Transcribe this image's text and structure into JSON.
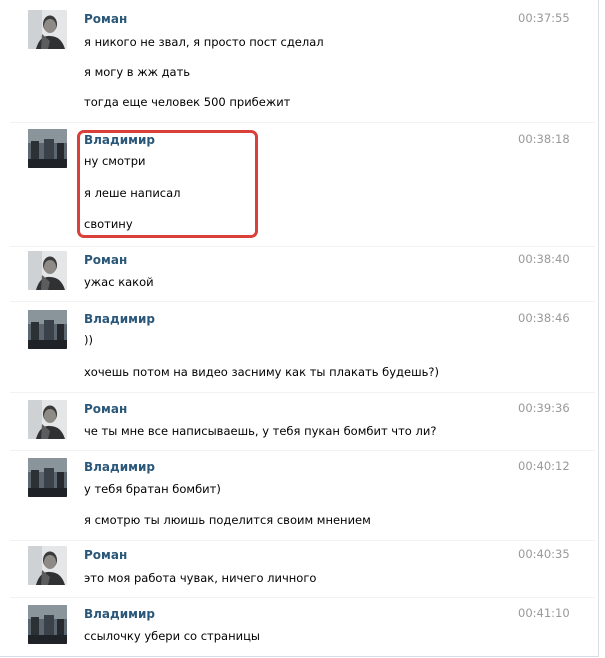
{
  "messages": [
    {
      "author": "Роман",
      "avatar": "roman-avatar-icon",
      "time": "00:37:55",
      "lines": [
        "я никого не звал, я просто пост сделал",
        "я могу в жж дать",
        "тогда еще человек 500 прибежит"
      ]
    },
    {
      "author": "Владимир",
      "avatar": "vladimir-avatar-icon",
      "time": "00:38:18",
      "lines": [
        "ну смотри",
        "я леше написал",
        "свотину"
      ]
    },
    {
      "author": "Роман",
      "avatar": "roman-avatar-icon",
      "time": "00:38:40",
      "lines": [
        "ужас какой"
      ]
    },
    {
      "author": "Владимир",
      "avatar": "vladimir-avatar-icon",
      "time": "00:38:46",
      "lines": [
        "))",
        "хочешь потом на видео засниму как ты плакать будешь?)"
      ]
    },
    {
      "author": "Роман",
      "avatar": "roman-avatar-icon",
      "time": "00:39:36",
      "lines": [
        "че ты мне все написываешь, у тебя пукан бомбит что ли?"
      ]
    },
    {
      "author": "Владимир",
      "avatar": "vladimir-avatar-icon",
      "time": "00:40:12",
      "lines": [
        "у тебя братан бомбит)",
        "я смотрю ты люишь поделится своим мнением"
      ]
    },
    {
      "author": "Роман",
      "avatar": "roman-avatar-icon",
      "time": "00:40:35",
      "lines": [
        "это моя работа чувак, ничего личного"
      ]
    },
    {
      "author": "Владимир",
      "avatar": "vladimir-avatar-icon",
      "time": "00:41:10",
      "lines": [
        "ссылочку убери со страницы"
      ]
    }
  ],
  "colors": {
    "author": "#2b587a",
    "time": "#999999",
    "highlight": "#d9403a"
  }
}
